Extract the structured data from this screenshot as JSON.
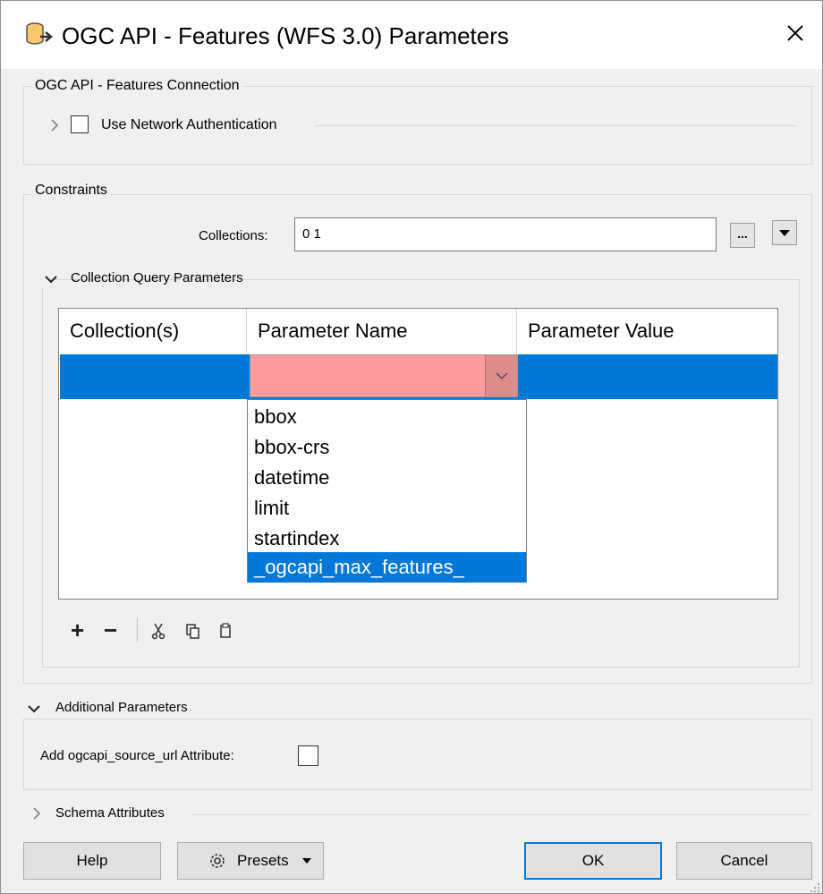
{
  "window": {
    "title": "OGC API - Features (WFS 3.0) Parameters"
  },
  "connection": {
    "group_label": "OGC API - Features Connection",
    "auth_label": "Use Network Authentication",
    "auth_checked": false
  },
  "constraints": {
    "group_label": "Constraints",
    "collections_label": "Collections:",
    "collections_value": "0 1",
    "browse_label": "..."
  },
  "query_params": {
    "section_label": "Collection Query Parameters",
    "columns": [
      "Collection(s)",
      "Parameter Name",
      "Parameter Value"
    ],
    "dropdown_options": [
      "bbox",
      "bbox-crs",
      "datetime",
      "limit",
      "startindex",
      "_ogcapi_max_features_"
    ],
    "selected_option": "_ogcapi_max_features_",
    "toolbar": {
      "add": "+",
      "remove": "−"
    }
  },
  "additional": {
    "section_label": "Additional Parameters",
    "source_url_label": "Add ogcapi_source_url Attribute:",
    "source_url_checked": false
  },
  "schema": {
    "section_label": "Schema Attributes"
  },
  "buttons": {
    "help": "Help",
    "presets": "Presets",
    "ok": "OK",
    "cancel": "Cancel"
  },
  "colors": {
    "accent": "#0078d7",
    "invalid_field": "#ff9b9b",
    "background": "#f0f0f0"
  }
}
